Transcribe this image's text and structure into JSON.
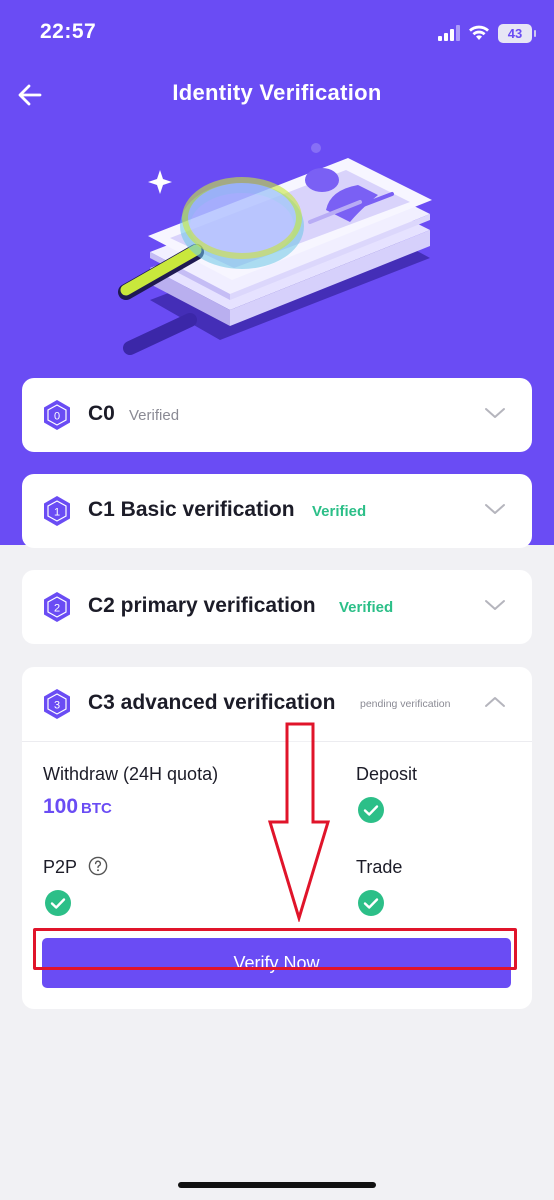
{
  "status_bar": {
    "time": "22:57",
    "battery": "43"
  },
  "nav": {
    "title": "Identity Verification"
  },
  "levels": [
    {
      "badge": "0",
      "title": "C0",
      "status": "Verified"
    },
    {
      "badge": "1",
      "title": "C1 Basic verification",
      "status": "Verified"
    },
    {
      "badge": "2",
      "title": "C2 primary verification",
      "status": "Verified"
    },
    {
      "badge": "3",
      "title": "C3 advanced verification",
      "status": "pending verification"
    }
  ],
  "c3_details": {
    "withdraw_label": "Withdraw (24H quota)",
    "withdraw_amount": "100",
    "withdraw_unit": "BTC",
    "deposit_label": "Deposit",
    "p2p_label": "P2P",
    "trade_label": "Trade",
    "verify_button": "Verify Now"
  },
  "colors": {
    "accent": "#6a4cf4",
    "verified": "#2cbf88",
    "highlight": "#e0142a"
  },
  "icons": [
    "back-arrow-icon",
    "signal-icon",
    "wifi-icon",
    "battery-icon",
    "chevron-down-icon",
    "chevron-up-icon",
    "check-circle-icon",
    "help-circle-icon"
  ]
}
